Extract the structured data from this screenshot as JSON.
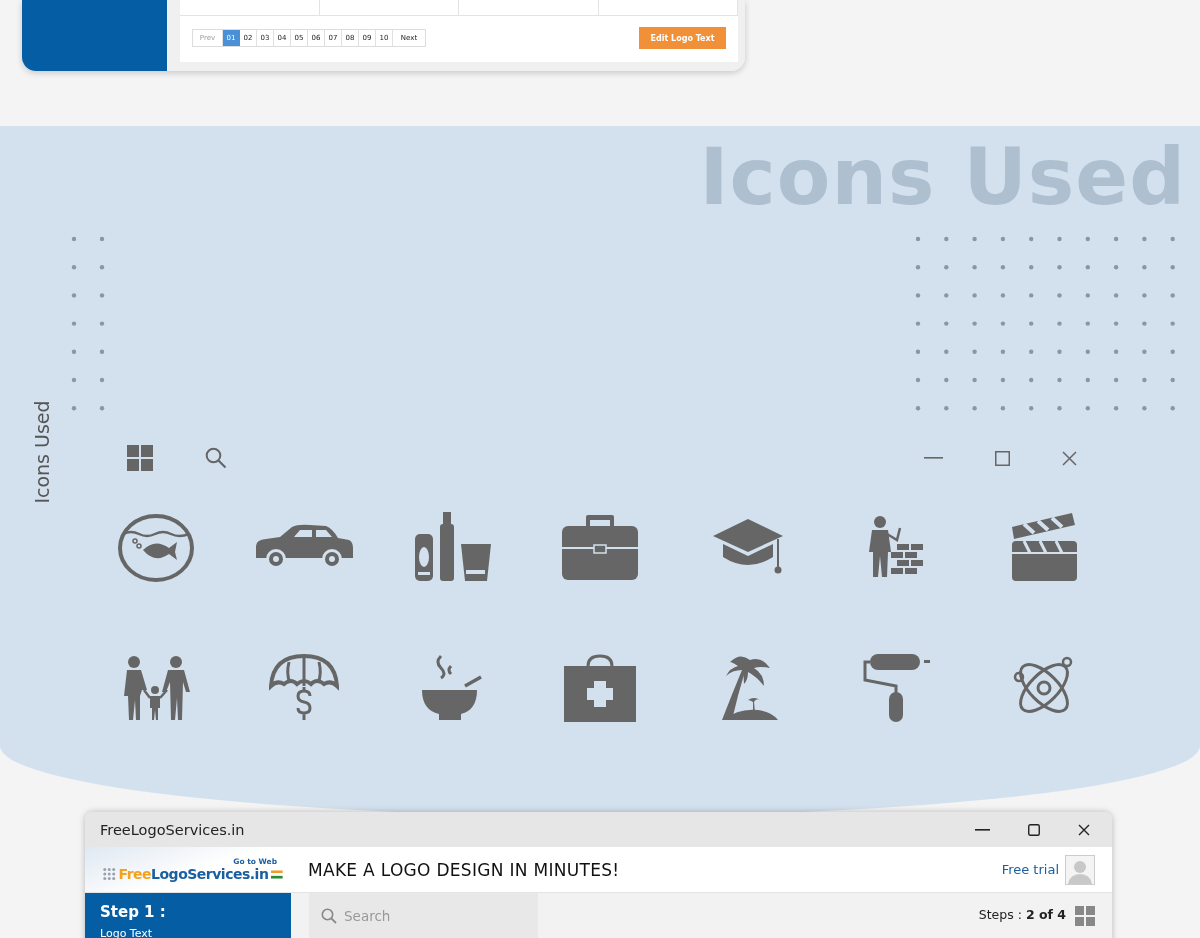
{
  "top_card": {
    "pagination": {
      "prev": "Prev",
      "next": "Next",
      "pages": [
        {
          "label": "01",
          "selected": true
        },
        {
          "label": "02",
          "selected": false
        },
        {
          "label": "03",
          "selected": false
        },
        {
          "label": "04",
          "selected": false
        },
        {
          "label": "05",
          "selected": false
        },
        {
          "label": "06",
          "selected": false
        },
        {
          "label": "07",
          "selected": false
        },
        {
          "label": "08",
          "selected": false
        },
        {
          "label": "09",
          "selected": false
        },
        {
          "label": "10",
          "selected": false
        }
      ]
    },
    "edit_button": "Edit Logo Text"
  },
  "icons_section": {
    "heading": "Icons Used",
    "side_label": "Icons Used",
    "icons": [
      {
        "kind": "fishbowl"
      },
      {
        "kind": "car"
      },
      {
        "kind": "bottles"
      },
      {
        "kind": "briefcase"
      },
      {
        "kind": "graduation-cap"
      },
      {
        "kind": "bricklayer"
      },
      {
        "kind": "clapperboard"
      },
      {
        "kind": "family"
      },
      {
        "kind": "umbrella-dollar"
      },
      {
        "kind": "bowl"
      },
      {
        "kind": "first-aid-kit"
      },
      {
        "kind": "palm-island"
      },
      {
        "kind": "paint-roller"
      },
      {
        "kind": "atom"
      }
    ]
  },
  "window": {
    "title": "FreeLogoServices.in",
    "logo": {
      "go_to_web": "Go to Web",
      "brand_first": "Free",
      "brand_rest": "LogoServices.in"
    },
    "headline": "MAKE A LOGO DESIGN IN MINUTES!",
    "free_trial": "Free trial",
    "sidebar": {
      "step": "Step 1 :",
      "item": "Logo Text"
    },
    "search": {
      "placeholder": "Search"
    },
    "steps": "Steps : **2 of 4**"
  }
}
